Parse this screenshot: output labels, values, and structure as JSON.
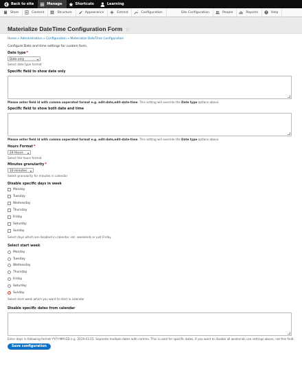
{
  "toolbar": {
    "items": [
      {
        "label": "Back to site",
        "icon": "back-arrow-icon"
      },
      {
        "label": "Manage",
        "icon": "hamburger-icon"
      },
      {
        "label": "Shortcuts",
        "icon": "star-icon"
      },
      {
        "label": "Learning",
        "icon": "person-icon"
      }
    ]
  },
  "tray": {
    "items": [
      {
        "label": "Store",
        "icon": "store-icon"
      },
      {
        "label": "Content",
        "icon": "content-icon"
      },
      {
        "label": "Structure",
        "icon": "structure-icon"
      },
      {
        "label": "Appearance",
        "icon": "appearance-icon"
      },
      {
        "label": "Extend",
        "icon": "extend-icon"
      },
      {
        "label": "Configuration",
        "icon": "configuration-icon"
      },
      {
        "label": "Site Configuration",
        "icon": ""
      },
      {
        "label": "People",
        "icon": "people-icon"
      },
      {
        "label": "Reports",
        "icon": "reports-icon"
      },
      {
        "label": "Help",
        "icon": "help-icon"
      }
    ]
  },
  "page": {
    "title": "Materialize DateTime Configuration Form",
    "star": "☆",
    "breadcrumb": [
      "Home",
      "Administration",
      "Configuration",
      "Materialize DateTime Configuration"
    ],
    "breadcrumb_sep": "»",
    "intro": "Configure Date and time settings for custom form."
  },
  "form": {
    "date_type": {
      "label": "Date type",
      "required": "*",
      "value": "Date only",
      "desc": "Select date type format"
    },
    "date_only_field": {
      "label": "Specific field to show date only",
      "desc_pre": "Please enter field id with comma seperated format e.g. edit-date,edit-date-time",
      "desc_mid": ". This setting will override the ",
      "desc_bold": "Date type",
      "desc_post": " options above."
    },
    "date_time_field": {
      "label": "Specific field to show both date and time",
      "desc_pre": "Please enter field id with comma seperated format e.g. edit-date,edit-date-time",
      "desc_mid": ". This setting will override the ",
      "desc_bold": "Date type",
      "desc_post": " options above."
    },
    "hours_format": {
      "label": "Hours Format",
      "required": "*",
      "value": "24 Hours",
      "desc": "Select the hours format"
    },
    "minutes_granularity": {
      "label": "Minutes granularity",
      "required": "*",
      "value": "10 minutes",
      "desc": "Select granularity for minutes in calendar"
    },
    "disable_days": {
      "label": "Disable specific days in week",
      "options": [
        "Monday",
        "Tuesday",
        "Wednesday",
        "Thursday",
        "Friday",
        "Saturday",
        "Sunday"
      ],
      "desc": "Select days which are disabled in calendar, etc. weekends or just Friday"
    },
    "start_week": {
      "label": "Select start week",
      "options": [
        "Monday",
        "Tuesday",
        "Wednesday",
        "Thursday",
        "Friday",
        "Saturday",
        "Sunday"
      ],
      "selected": "Sunday",
      "desc": "Select start week which you want to start in calendar"
    },
    "disable_dates": {
      "label": "Disable specific dates from calendar",
      "desc": "Enter days in following format YYYY-MM-DD e.g. 2019-03-15. Separate multiple dates with comma. This is used for specific dates, if you want to disable all weekends use settings above, not this field."
    },
    "submit_label": "Save configuration"
  },
  "colors": {
    "toolbar_bg": "#0f0f0f",
    "accent": "#0f72c6",
    "radio_selected": "#e2391e"
  }
}
